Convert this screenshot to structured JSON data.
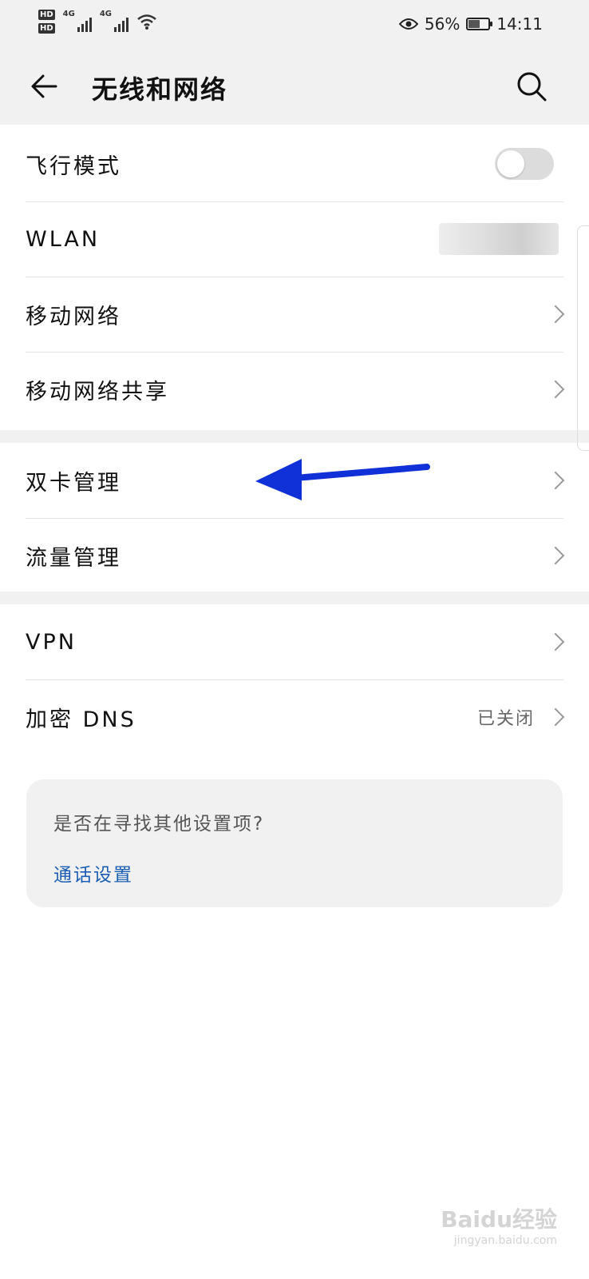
{
  "status_bar": {
    "sim1_label": "HD",
    "sim2_label": "HD",
    "network1": "4G",
    "network2": "4G",
    "battery_percent": "56%",
    "battery_level": 0.56,
    "time": "14:11"
  },
  "header": {
    "title": "无线和网络"
  },
  "sections": {
    "airplane": {
      "label": "飞行模式",
      "toggle_on": false
    },
    "wlan": {
      "label": "WLAN"
    },
    "mobile_network": {
      "label": "移动网络"
    },
    "hotspot": {
      "label": "移动网络共享"
    },
    "dual_sim": {
      "label": "双卡管理"
    },
    "data_usage": {
      "label": "流量管理"
    },
    "vpn": {
      "label": "VPN"
    },
    "dns": {
      "label": "加密 DNS",
      "value": "已关闭"
    }
  },
  "suggestion_card": {
    "question": "是否在寻找其他设置项?",
    "link": "通话设置"
  },
  "watermark": {
    "brand": "Baidu经验",
    "url": "jingyan.baidu.com"
  },
  "colors": {
    "link": "#1a5fb4",
    "arrow": "#1030d8",
    "background_gray": "#f1f1f1"
  }
}
